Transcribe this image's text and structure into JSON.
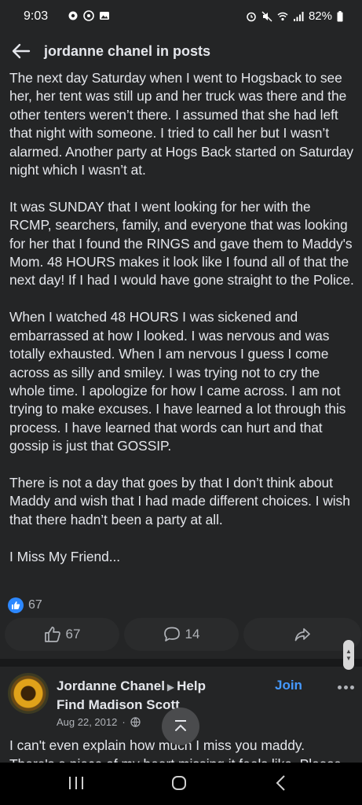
{
  "status_bar": {
    "time": "9:03",
    "battery": "82%"
  },
  "header": {
    "title": "jordanne chanel in posts"
  },
  "post": {
    "paragraphs": [
      "The next day Saturday when I went to Hogsback to see her, her tent was still up and her truck was there and the other tenters weren’t there.  I assumed that she had left that night with someone.  I tried to call her but I wasn’t alarmed.  Another party at Hogs Back started on Saturday night which I wasn’t at.",
      " It was SUNDAY that I went looking for her with the RCMP, searchers, family, and everyone that was looking for her that I found the RINGS and gave them to Maddy's Mom.  48 HOURS makes it look like I found all of that the next day! If I had I would have gone straight to the Police.",
      "When I watched 48 HOURS I was sickened and embarrassed at how I looked.  I was nervous and was totally exhausted.  When I am nervous I guess I come across as silly and smiley.  I was trying not to cry the whole time.  I apologize for how I came across.  I am not trying to make excuses.  I have learned a lot through this process.  I have learned that words can hurt and that gossip is just that GOSSIP.",
      "There is not a day that goes by that I don’t think about Maddy and wish that I had made different choices. I wish that there hadn’t been a party at all.",
      "I Miss My Friend..."
    ],
    "reaction_count": "67",
    "like_count": "67",
    "comment_count": "14"
  },
  "comment": {
    "author": "Jordanne Chanel",
    "group": "Help",
    "group_line2": "Find Madison Scott",
    "join_label": "Join",
    "date": "Aug 22, 2012",
    "separator": "·",
    "text": "I can't even explain how much I miss you maddy.",
    "text_cut": "There's a piece of my heart missing it feels like. Please"
  },
  "colors": {
    "background": "#242526",
    "accent": "#2d88ff",
    "join": "#4599ff"
  },
  "icons": {
    "back": "arrow-left-icon",
    "like": "thumbs-up-icon",
    "comment": "comment-bubble-icon",
    "share": "share-arrow-icon",
    "globe": "globe-icon",
    "scroll_top": "chevron-up-bar-icon"
  }
}
